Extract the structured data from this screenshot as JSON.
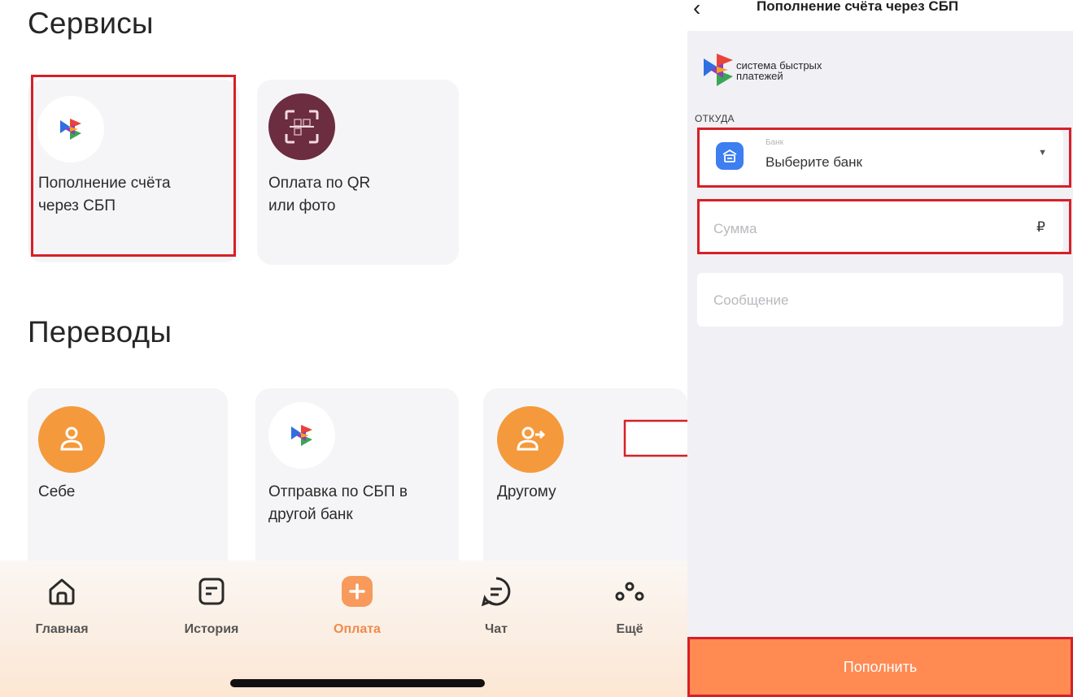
{
  "services": {
    "title": "Сервисы",
    "cards": [
      {
        "label": "Пополнение счёта\nчерез СБП",
        "icon": "sbp-logo-icon"
      },
      {
        "label": "Оплата по QR\nили фото",
        "icon": "qr-scan-icon"
      }
    ]
  },
  "transfers": {
    "title": "Переводы",
    "cards": [
      {
        "label": "Себе",
        "icon": "person-icon"
      },
      {
        "label": "Отправка по СБП в\nдругой банк",
        "icon": "sbp-logo-icon"
      },
      {
        "label": "Другому",
        "icon": "person-arrow-icon"
      }
    ]
  },
  "nav": {
    "items": [
      {
        "label": "Главная",
        "icon": "home-icon"
      },
      {
        "label": "История",
        "icon": "history-icon"
      },
      {
        "label": "Оплата",
        "icon": "plus-icon",
        "active": true
      },
      {
        "label": "Чат",
        "icon": "chat-icon"
      },
      {
        "label": "Ещё",
        "icon": "more-icon"
      }
    ]
  },
  "form": {
    "title": "Пополнение счёта через СБП",
    "logo_text": "система быстрых\nплатежей",
    "from_label": "ОТКУДА",
    "bank_caption": "Банк",
    "bank_value": "Выберите банк",
    "amount_placeholder": "Сумма",
    "currency": "₽",
    "message_placeholder": "Сообщение",
    "submit": "Пополнить"
  },
  "colors": {
    "accent": "#ff8a52",
    "highlight": "#d62027",
    "bank_icon": "#3d7ef0",
    "qr_circle": "#6b2d3f",
    "person_circle": "#f49a3c"
  }
}
